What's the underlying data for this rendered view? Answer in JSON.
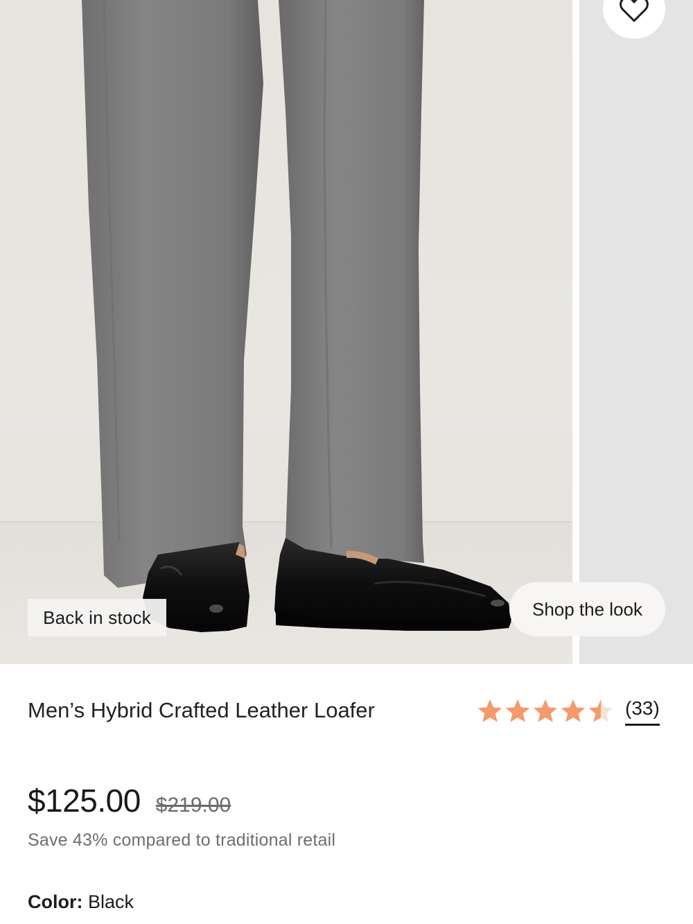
{
  "gallery": {
    "badge_text": "Back in stock",
    "shop_the_look_label": "Shop the look",
    "wishlist_icon": "heart-icon"
  },
  "product": {
    "title": "Men’s Hybrid Crafted Leather Loafer",
    "rating": 4.5,
    "rating_max": 5,
    "review_count": "(33)",
    "sale_price": "$125.00",
    "original_price": "$219.00",
    "savings_text": "Save 43% compared to traditional retail",
    "color_label": "Color:",
    "color_value": "Black"
  },
  "colors": {
    "star": "#F59A6B",
    "star_empty": "#F7E2D6",
    "text": "#1C1C1C",
    "muted": "#6E6E6E",
    "trousers": "#7C7C7C",
    "shoe": "#111111"
  }
}
